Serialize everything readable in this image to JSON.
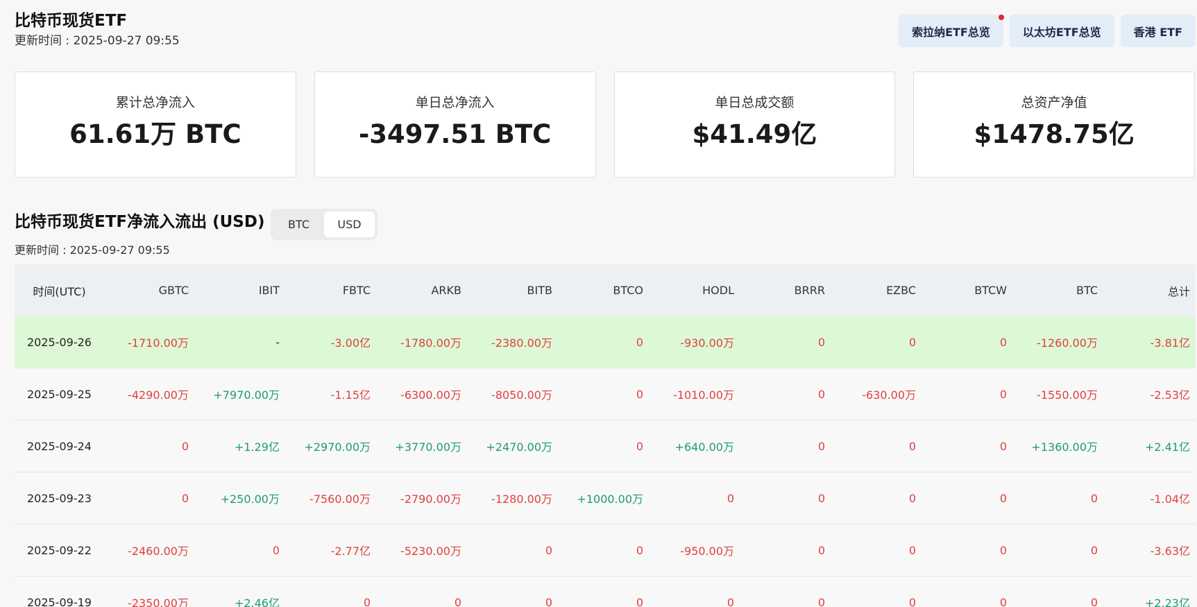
{
  "header": {
    "title": "比特币现货ETF",
    "update_time": "更新时间 : 2025-09-27 09:55"
  },
  "nav": {
    "solana": "索拉纳ETF总览",
    "ethereum": "以太坊ETF总览",
    "hongkong": "香港 ETF"
  },
  "stats": [
    {
      "label": "累计总净流入",
      "value": "61.61万 BTC"
    },
    {
      "label": "单日总净流入",
      "value": "-3497.51 BTC"
    },
    {
      "label": "单日总成交额",
      "value": "$41.49亿"
    },
    {
      "label": "总资产净值",
      "value": "$1478.75亿"
    }
  ],
  "section": {
    "title": "比特币现货ETF净流入流出 (USD)",
    "toggle_btc": "BTC",
    "toggle_usd": "USD",
    "toggle_selected": "USD",
    "update_time": "更新时间 : 2025-09-27 09:55"
  },
  "table": {
    "headers": [
      "时间(UTC)",
      "GBTC",
      "IBIT",
      "FBTC",
      "ARKB",
      "BITB",
      "BTCO",
      "HODL",
      "BRRR",
      "EZBC",
      "BTCW",
      "BTC",
      "总计"
    ],
    "rows": [
      {
        "date": "2025-09-26",
        "highlight": true,
        "cells": [
          "-1710.00万",
          "-",
          "-3.00亿",
          "-1780.00万",
          "-2380.00万",
          "0",
          "-930.00万",
          "0",
          "0",
          "0",
          "-1260.00万",
          "-3.81亿"
        ],
        "signs": [
          "neg",
          "neu",
          "neg",
          "neg",
          "neg",
          "neg",
          "neg",
          "neg",
          "neg",
          "neg",
          "neg",
          "neg"
        ]
      },
      {
        "date": "2025-09-25",
        "highlight": false,
        "cells": [
          "-4290.00万",
          "+7970.00万",
          "-1.15亿",
          "-6300.00万",
          "-8050.00万",
          "0",
          "-1010.00万",
          "0",
          "-630.00万",
          "0",
          "-1550.00万",
          "-2.53亿"
        ],
        "signs": [
          "neg",
          "pos",
          "neg",
          "neg",
          "neg",
          "neg",
          "neg",
          "neg",
          "neg",
          "neg",
          "neg",
          "neg"
        ]
      },
      {
        "date": "2025-09-24",
        "highlight": false,
        "cells": [
          "0",
          "+1.29亿",
          "+2970.00万",
          "+3770.00万",
          "+2470.00万",
          "0",
          "+640.00万",
          "0",
          "0",
          "0",
          "+1360.00万",
          "+2.41亿"
        ],
        "signs": [
          "neg",
          "pos",
          "pos",
          "pos",
          "pos",
          "neg",
          "pos",
          "neg",
          "neg",
          "neg",
          "pos",
          "pos"
        ]
      },
      {
        "date": "2025-09-23",
        "highlight": false,
        "cells": [
          "0",
          "+250.00万",
          "-7560.00万",
          "-2790.00万",
          "-1280.00万",
          "+1000.00万",
          "0",
          "0",
          "0",
          "0",
          "0",
          "-1.04亿"
        ],
        "signs": [
          "neg",
          "pos",
          "neg",
          "neg",
          "neg",
          "pos",
          "neg",
          "neg",
          "neg",
          "neg",
          "neg",
          "neg"
        ]
      },
      {
        "date": "2025-09-22",
        "highlight": false,
        "cells": [
          "-2460.00万",
          "0",
          "-2.77亿",
          "-5230.00万",
          "0",
          "0",
          "-950.00万",
          "0",
          "0",
          "0",
          "0",
          "-3.63亿"
        ],
        "signs": [
          "neg",
          "neg",
          "neg",
          "neg",
          "neg",
          "neg",
          "neg",
          "neg",
          "neg",
          "neg",
          "neg",
          "neg"
        ]
      },
      {
        "date": "2025-09-19",
        "highlight": false,
        "cells": [
          "-2350.00万",
          "+2.46亿",
          "0",
          "0",
          "0",
          "0",
          "0",
          "0",
          "0",
          "0",
          "0",
          "+2.23亿"
        ],
        "signs": [
          "neg",
          "pos",
          "neg",
          "neg",
          "neg",
          "neg",
          "neg",
          "neg",
          "neg",
          "neg",
          "neg",
          "pos"
        ]
      }
    ]
  },
  "colors": {
    "positive": "#1e9b76",
    "negative": "#e0403f",
    "highlight_row": "#ddf8d6",
    "nav_button_bg": "#e2edf8",
    "notification_dot": "#e8262b"
  }
}
